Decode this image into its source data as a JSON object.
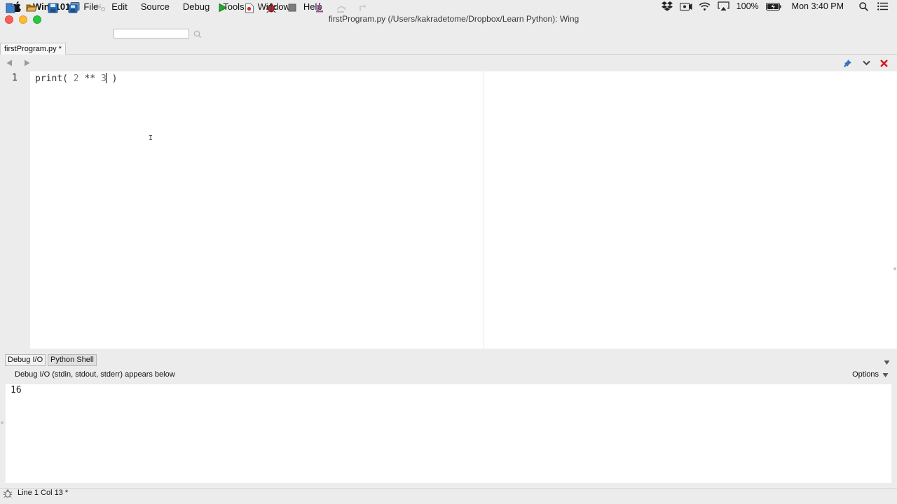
{
  "menubar": {
    "app_name": "Wing101",
    "items": [
      "File",
      "Edit",
      "Source",
      "Debug",
      "Tools",
      "Window",
      "Help"
    ],
    "battery": "100%",
    "clock": "Mon 3:40 PM"
  },
  "window": {
    "title": "firstProgram.py (/Users/kakradetome/Dropbox/Learn Python): Wing"
  },
  "toolbar": {
    "search_value": ""
  },
  "editor": {
    "tab_label": "firstProgram.py *",
    "line_number": "1",
    "code": {
      "fn": "print( ",
      "n1": "2",
      "op": " ** ",
      "n2": "3",
      "tail": " )"
    }
  },
  "bottom_panel": {
    "tabs": [
      "Debug I/O",
      "Python Shell"
    ],
    "description": "Debug I/O (stdin, stdout, stderr) appears below",
    "options_label": "Options",
    "output": "16"
  },
  "status": {
    "text": "Line 1 Col 13 *"
  },
  "colors": {
    "run_icon": "#1faa2b",
    "close_icon": "#d21a1a",
    "traffic_red": "#fc5f57",
    "traffic_yellow": "#fdbc2e",
    "traffic_green": "#28c840"
  }
}
